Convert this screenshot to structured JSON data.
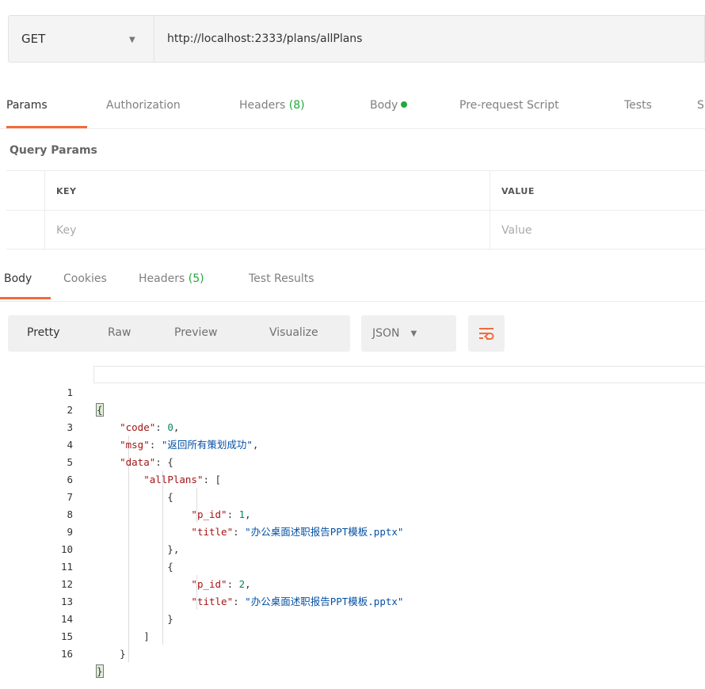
{
  "request": {
    "method": "GET",
    "url": "http://localhost:2333/plans/allPlans"
  },
  "request_tabs": [
    {
      "label": "Params"
    },
    {
      "label": "Authorization"
    },
    {
      "label": "Headers",
      "count": "(8)"
    },
    {
      "label": "Body"
    },
    {
      "label": "Pre-request Script"
    },
    {
      "label": "Tests"
    },
    {
      "label": "S"
    }
  ],
  "query_params": {
    "title": "Query Params",
    "key_header": "KEY",
    "value_header": "VALUE",
    "key_placeholder": "Key",
    "value_placeholder": "Value"
  },
  "response_tabs": [
    {
      "label": "Body"
    },
    {
      "label": "Cookies"
    },
    {
      "label": "Headers",
      "count": "(5)"
    },
    {
      "label": "Test Results"
    }
  ],
  "format": {
    "modes": [
      "Pretty",
      "Raw",
      "Preview",
      "Visualize"
    ],
    "language": "JSON"
  },
  "code_lines": [
    "1",
    "2",
    "3",
    "4",
    "5",
    "6",
    "7",
    "8",
    "9",
    "10",
    "11",
    "12",
    "13",
    "14",
    "15",
    "16"
  ],
  "code": {
    "open_brace": "{",
    "close_brace": "}",
    "k_code": "\"code\"",
    "v_code": "0",
    "k_msg": "\"msg\"",
    "v_msg": "\"返回所有策划成功\"",
    "k_data": "\"data\"",
    "k_allplans": "\"allPlans\"",
    "k_pid": "\"p_id\"",
    "v_pid_1": "1",
    "v_pid_2": "2",
    "k_title": "\"title\"",
    "v_title_1": "\"办公桌面述职报告PPT模板.pptx\"",
    "v_title_2": "\"办公桌面述职报告PPT模板.pptx\""
  },
  "colors": {
    "accent": "#f26b3a",
    "green": "#21a93c"
  },
  "icons": {
    "wrap": "wrap-lines-icon",
    "caret": "chevron-down-icon"
  }
}
